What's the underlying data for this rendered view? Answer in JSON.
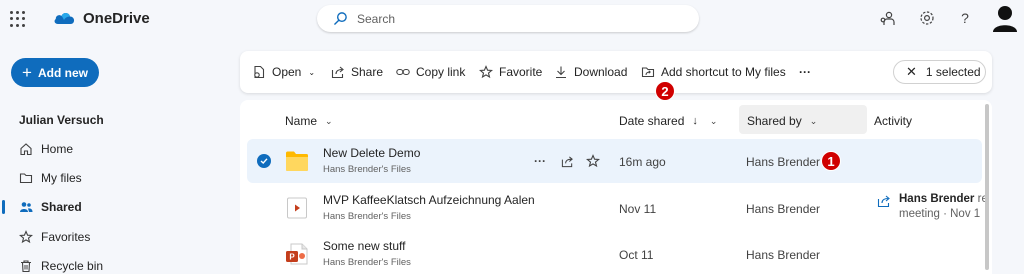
{
  "app": {
    "name": "OneDrive"
  },
  "search": {
    "placeholder": "Search"
  },
  "header_icons": [
    "share-people-icon",
    "gear-icon",
    "help-icon",
    "avatar-icon"
  ],
  "nav": {
    "new_label": "Add new",
    "user": "Julian Versuch",
    "items": [
      {
        "label": "Home",
        "icon": "home-icon"
      },
      {
        "label": "My files",
        "icon": "folder-icon"
      },
      {
        "label": "Shared",
        "icon": "people-icon",
        "active": true
      },
      {
        "label": "Favorites",
        "icon": "star-icon"
      },
      {
        "label": "Recycle bin",
        "icon": "trash-icon"
      }
    ]
  },
  "toolbar": {
    "open": "Open",
    "share": "Share",
    "copy_link": "Copy link",
    "favorite": "Favorite",
    "download": "Download",
    "add_shortcut": "Add shortcut to My files",
    "more": "···",
    "selected": "1 selected"
  },
  "columns": {
    "name": "Name",
    "date_shared": "Date shared",
    "shared_by": "Shared by",
    "activity": "Activity"
  },
  "rows": [
    {
      "name": "New Delete Demo",
      "sub": "Hans Brender's Files",
      "date": "16m ago",
      "shared_by": "Hans Brender",
      "type": "folder",
      "selected": true
    },
    {
      "name": "MVP KaffeeKlatsch Aufzeichnung Aalen",
      "sub": "Hans Brender's Files",
      "date": "Nov 11",
      "shared_by": "Hans Brender",
      "type": "video",
      "activity_name": "Hans Brender",
      "activity_rest": " re",
      "activity_sub": "meeting · Nov 1"
    },
    {
      "name": "Some new stuff",
      "sub": "Hans Brender's Files",
      "date": "Oct 11",
      "shared_by": "Hans Brender",
      "type": "powerpoint"
    }
  ],
  "annotations": {
    "badge1": "1",
    "badge2": "2"
  },
  "colors": {
    "accent": "#0f6cbd",
    "badge": "#d00000",
    "folder": "#ffb900",
    "selected_row": "#ebf3fc"
  }
}
